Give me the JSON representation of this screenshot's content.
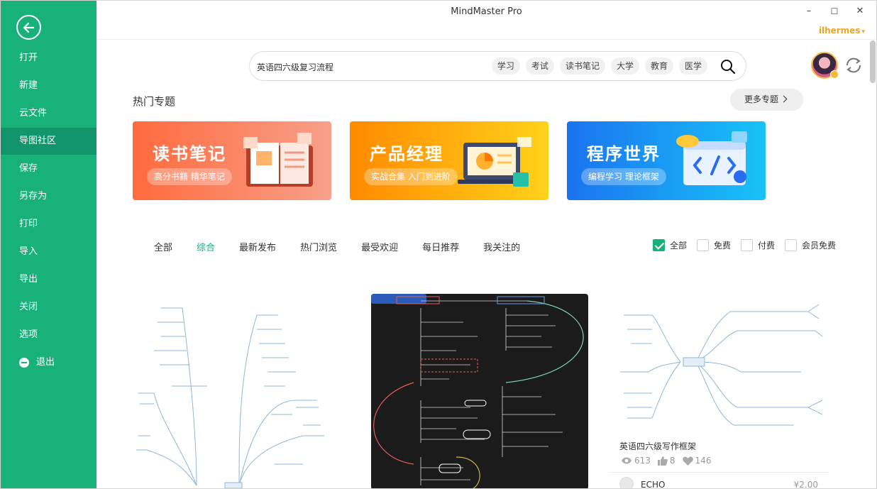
{
  "window": {
    "title": "MindMaster Pro",
    "username": "ilhermes",
    "minimize": "–",
    "maximize": "☐",
    "close": "✕"
  },
  "sidebar": {
    "items": [
      {
        "label": "打开"
      },
      {
        "label": "新建"
      },
      {
        "label": "云文件"
      },
      {
        "label": "导图社区"
      },
      {
        "label": "保存"
      },
      {
        "label": "另存为"
      },
      {
        "label": "打印"
      },
      {
        "label": "导入"
      },
      {
        "label": "导出"
      },
      {
        "label": "关闭"
      },
      {
        "label": "选项"
      },
      {
        "label": "退出"
      }
    ],
    "active_index": 3
  },
  "search": {
    "value": "英语四六级复习流程",
    "tags": [
      "学习",
      "考试",
      "读书笔记",
      "大学",
      "教育",
      "医学"
    ]
  },
  "hot": {
    "title": "热门专题",
    "more_label": "更多专题",
    "banners": [
      {
        "title": "读书笔记",
        "subtitle": "高分书籍 精华笔记"
      },
      {
        "title": "产品经理",
        "subtitle": "实战合集 入门到进阶"
      },
      {
        "title": "程序世界",
        "subtitle": "编程学习 理论框架"
      }
    ]
  },
  "tabs": [
    "全部",
    "综合",
    "最新发布",
    "热门浏览",
    "最受欢迎",
    "每日推荐",
    "我关注的"
  ],
  "active_tab": 1,
  "filters": [
    {
      "label": "全部",
      "checked": true
    },
    {
      "label": "免费",
      "checked": false
    },
    {
      "label": "付费",
      "checked": false
    },
    {
      "label": "会员免费",
      "checked": false
    }
  ],
  "cards": [
    {
      "title": "英语四六级写作框架",
      "views": "613",
      "likes": "8",
      "favorites": "146",
      "author": "ECHO",
      "price": "¥2.00"
    }
  ],
  "colors": {
    "accent": "#17b179",
    "sidebar": "#17b179",
    "username": "#f0a51e"
  }
}
